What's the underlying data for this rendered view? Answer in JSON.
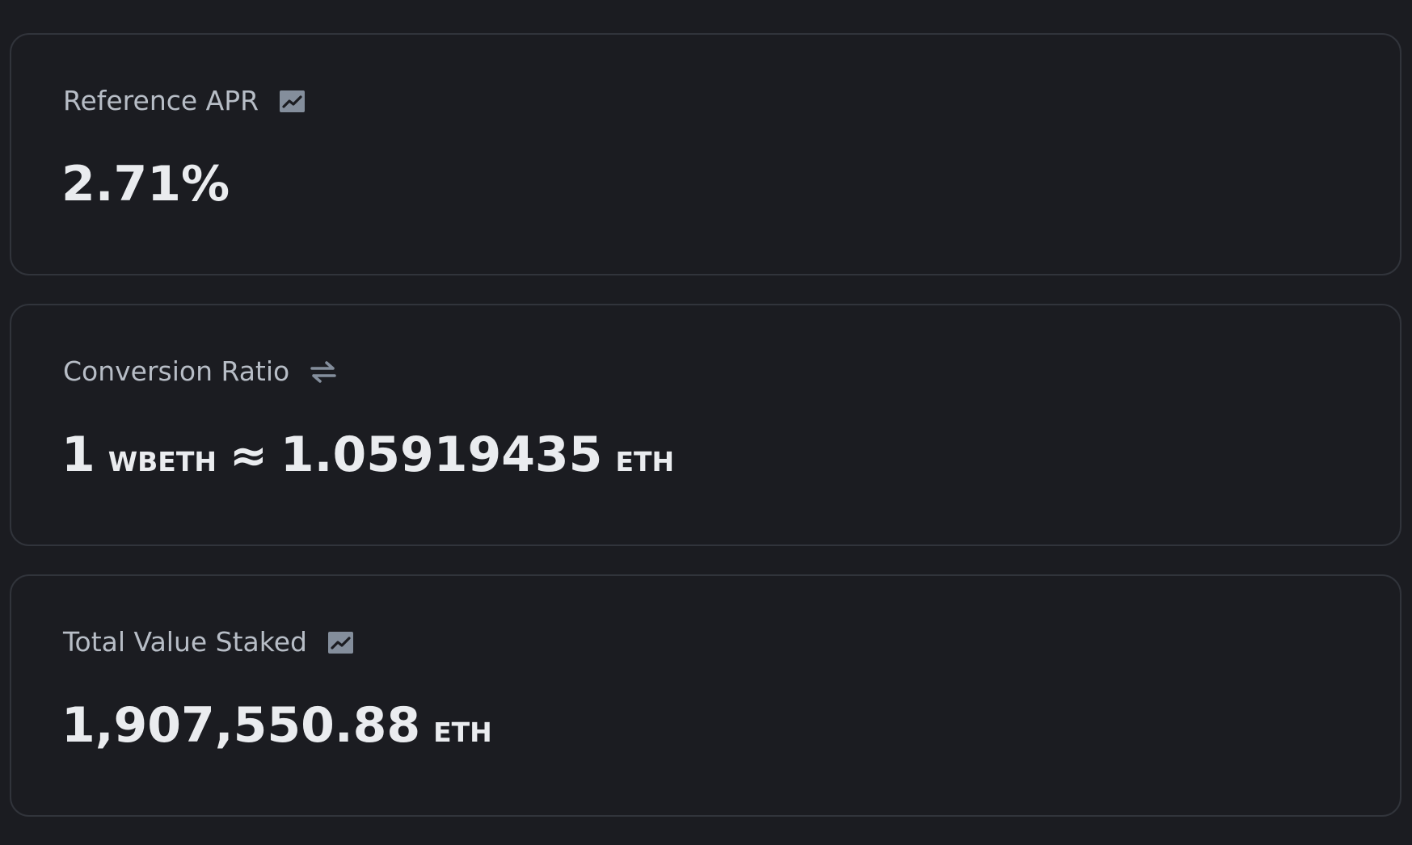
{
  "cards": [
    {
      "label": "Reference APR",
      "icon": "chart-icon",
      "value": "2.71%"
    },
    {
      "label": "Conversion Ratio",
      "icon": "swap-icon",
      "lhs_amount": "1",
      "lhs_unit": "WBETH",
      "approx_symbol": "≈",
      "rhs_amount": "1.05919435",
      "rhs_unit": "ETH"
    },
    {
      "label": "Total Value Staked",
      "icon": "chart-icon",
      "value": "1,907,550.88",
      "unit": "ETH"
    }
  ],
  "colors": {
    "background": "#1b1c21",
    "card_border": "#31343b",
    "label_text": "#b7bdc6",
    "value_text": "#eaecef",
    "icon_color": "#848e9c"
  }
}
